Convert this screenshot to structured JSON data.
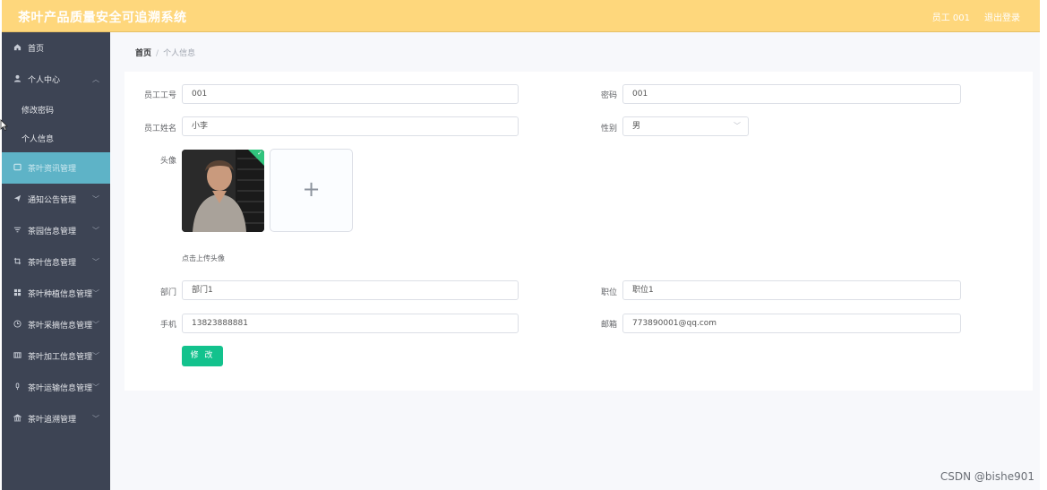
{
  "header": {
    "title": "茶叶产品质量安全可追溯系统",
    "user": "员工 001",
    "logout": "退出登录"
  },
  "sidebar": {
    "items": [
      {
        "label": "首页",
        "icon": "home-icon"
      },
      {
        "label": "个人中心",
        "icon": "user-icon",
        "sub": [
          {
            "label": "修改密码"
          },
          {
            "label": "个人信息"
          }
        ]
      },
      {
        "label": "茶叶资讯管理",
        "icon": "news-icon"
      },
      {
        "label": "通知公告管理",
        "icon": "send-icon"
      },
      {
        "label": "茶园信息管理",
        "icon": "filter-icon"
      },
      {
        "label": "茶叶信息管理",
        "icon": "crop-icon"
      },
      {
        "label": "茶叶种植信息管理",
        "icon": "grid-icon"
      },
      {
        "label": "茶叶采摘信息管理",
        "icon": "clock-icon"
      },
      {
        "label": "茶叶加工信息管理",
        "icon": "factory-icon"
      },
      {
        "label": "茶叶运输信息管理",
        "icon": "mic-icon"
      },
      {
        "label": "茶叶追溯管理",
        "icon": "bank-icon"
      }
    ]
  },
  "breadcrumb": {
    "home": "首页",
    "separator": "/",
    "current": "个人信息"
  },
  "form": {
    "emp_no": {
      "label": "员工工号",
      "value": "001"
    },
    "password": {
      "label": "密码",
      "value": "001"
    },
    "name": {
      "label": "员工姓名",
      "value": "小李"
    },
    "gender": {
      "label": "性别",
      "value": "男"
    },
    "avatar": {
      "label": "头像",
      "hint": "点击上传头像"
    },
    "department": {
      "label": "部门",
      "value": "部门1"
    },
    "position": {
      "label": "职位",
      "value": "职位1"
    },
    "phone": {
      "label": "手机",
      "value": "13823888881"
    },
    "email": {
      "label": "邮箱",
      "value": "773890001@qq.com"
    },
    "submit": "修 改"
  },
  "watermark": "CSDN @bishe901",
  "colors": {
    "header": "#fed77c",
    "sidebar": "#3d4454",
    "active": "#5eb3c7",
    "button": "#13c28d"
  }
}
